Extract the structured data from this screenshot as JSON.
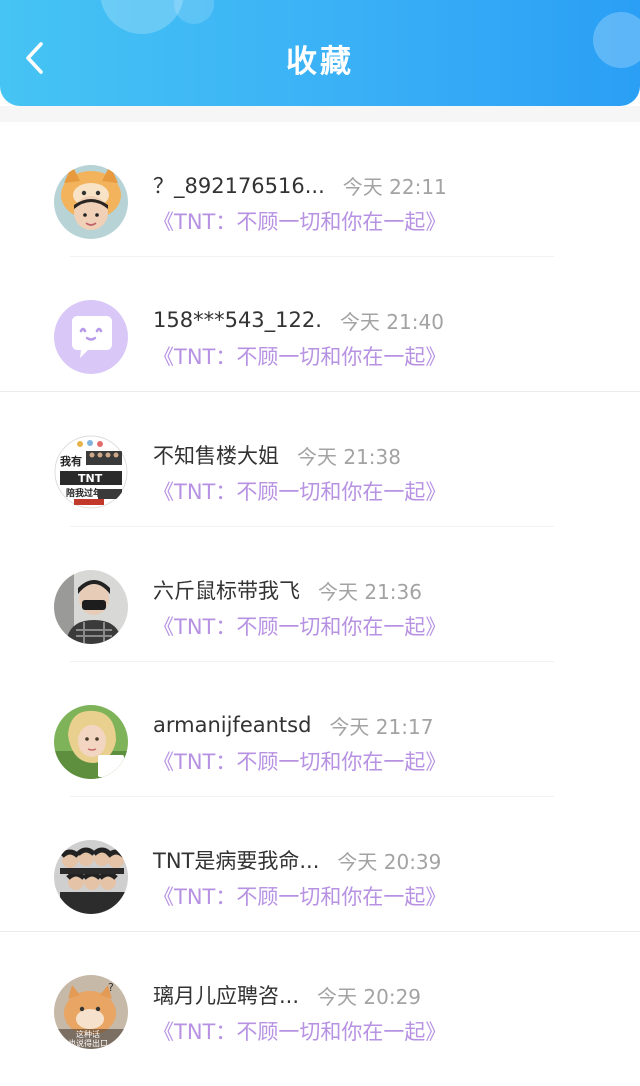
{
  "header": {
    "title": "收藏",
    "back_icon": "chevron-left-icon"
  },
  "colors": {
    "header_gradient_start": "#46c4f3",
    "header_gradient_end": "#2a9ff5",
    "novel_link": "#b792e2",
    "time_text": "#a3a3a3",
    "name_text": "#333333"
  },
  "favorites": [
    {
      "name": "？_892176516...",
      "time": "今天 22:11",
      "novel": "《TNT：不顾一切和你在一起》"
    },
    {
      "name": "158***543_122.",
      "time": "今天 21:40",
      "novel": "《TNT：不顾一切和你在一起》"
    },
    {
      "name": "不知售楼大姐",
      "time": "今天 21:38",
      "novel": "《TNT：不顾一切和你在一起》"
    },
    {
      "name": "六斤鼠标带我飞",
      "time": "今天 21:36",
      "novel": "《TNT：不顾一切和你在一起》"
    },
    {
      "name": "armanijfeantsd",
      "time": "今天 21:17",
      "novel": "《TNT：不顾一切和你在一起》"
    },
    {
      "name": "TNT是病要我命...",
      "time": "今天 20:39",
      "novel": "《TNT：不顾一切和你在一起》"
    },
    {
      "name": "璃月儿应聘咨...",
      "time": "今天 20:29",
      "novel": "《TNT：不顾一切和你在一起》"
    }
  ],
  "avatar_texts": {
    "row3_top": "我有",
    "row3_mid": "TNT",
    "row3_bottom": "陪我过年",
    "row7_line1": "这种话",
    "row7_line2": "你也说得出口"
  }
}
